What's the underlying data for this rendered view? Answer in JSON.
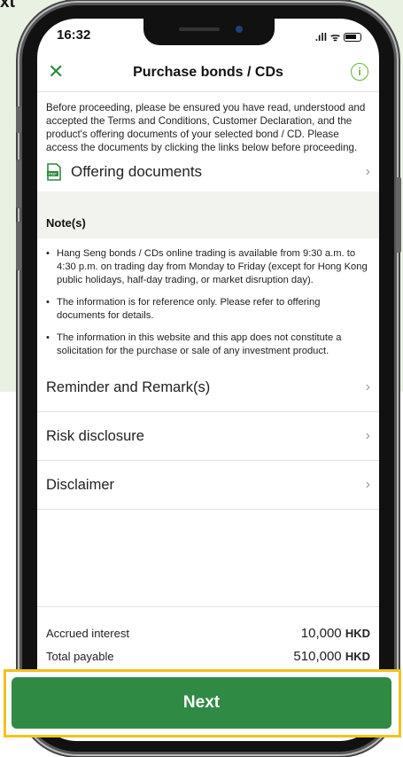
{
  "corner_label": "xt",
  "status_bar": {
    "time": "16:32",
    "signal": ".ıll",
    "wifi": "ᯤ"
  },
  "header": {
    "title": "Purchase bonds / CDs",
    "close_icon": "close-icon",
    "info_icon": "info-icon"
  },
  "intro_text": "Before proceeding, please be ensured you have read, understood and accepted the Terms and Conditions, Customer Declaration, and the product's offering documents of your selected bond / CD. Please access the documents by clicking the links below before proceeding.",
  "offering_documents_label": "Offering documents",
  "notes": {
    "title": "Note(s)",
    "items": [
      "Hang Seng bonds / CDs online trading is available from 9:30 a.m. to 4:30 p.m. on trading day from Monday to Friday (except for Hong Kong public holidays, half-day trading, or market disruption day).",
      "The information is for reference only. Please refer to offering documents for details.",
      "The information in this website and this app does not constitute a solicitation for the purchase or sale of any investment product."
    ]
  },
  "links": [
    "Reminder and Remark(s)",
    "Risk disclosure",
    "Disclaimer"
  ],
  "summary": {
    "accrued_interest_label": "Accrued interest",
    "accrued_interest_value": "10,000",
    "total_payable_label": "Total payable",
    "total_payable_value": "510,000",
    "currency": "HKD"
  },
  "next_button": "Next",
  "colors": {
    "brand_green": "#2f8a43",
    "highlight": "#f2c21b",
    "background_green": "#e9f1e3"
  }
}
